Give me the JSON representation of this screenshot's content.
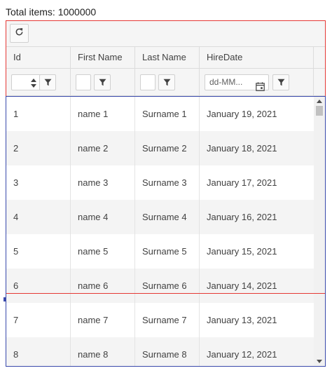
{
  "total_items": "Total items: 1000000",
  "toolbar": {
    "refresh_icon": "refresh-icon"
  },
  "columns": [
    {
      "label": "Id"
    },
    {
      "label": "First Name"
    },
    {
      "label": "Last Name"
    },
    {
      "label": "HireDate"
    }
  ],
  "filters": {
    "date_placeholder": "dd-MM...",
    "filter_icon": "filter-icon",
    "calendar_icon": "calendar-icon"
  },
  "rows": [
    {
      "id": "1",
      "first": "name 1",
      "last": "Surname 1",
      "hire": "January 19, 2021"
    },
    {
      "id": "2",
      "first": "name 2",
      "last": "Surname 2",
      "hire": "January 18, 2021"
    },
    {
      "id": "3",
      "first": "name 3",
      "last": "Surname 3",
      "hire": "January 17, 2021"
    },
    {
      "id": "4",
      "first": "name 4",
      "last": "Surname 4",
      "hire": "January 16, 2021"
    },
    {
      "id": "5",
      "first": "name 5",
      "last": "Surname 5",
      "hire": "January 15, 2021"
    },
    {
      "id": "6",
      "first": "name 6",
      "last": "Surname 6",
      "hire": "January 14, 2021"
    },
    {
      "id": "7",
      "first": "name 7",
      "last": "Surname 7",
      "hire": "January 13, 2021"
    },
    {
      "id": "8",
      "first": "name 8",
      "last": "Surname 8",
      "hire": "January 12, 2021"
    }
  ],
  "colors": {
    "outline_red": "#e53935",
    "outline_blue": "#3949ab",
    "header_bg": "#f5f5f5",
    "alt_row_bg": "#f4f4f4"
  }
}
